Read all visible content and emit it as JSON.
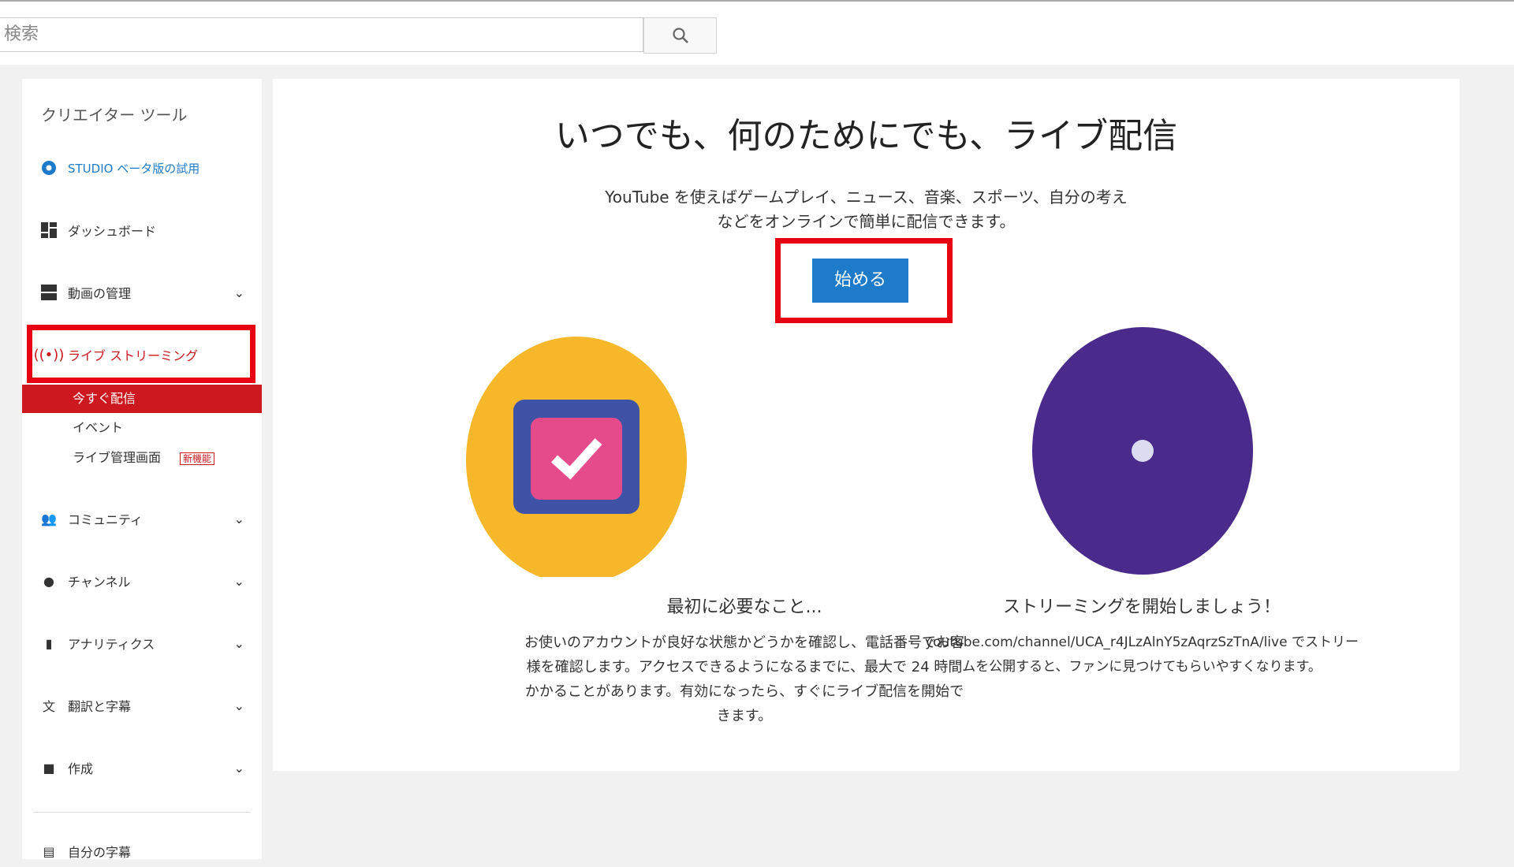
{
  "search": {
    "placeholder": "検索"
  },
  "sidebar": {
    "header": "クリエイター ツール",
    "studio": "STUDIO ベータ版の試用",
    "items": [
      {
        "label": "ダッシュボード"
      },
      {
        "label": "動画の管理"
      },
      {
        "label": "ライブ ストリーミング"
      },
      {
        "label": "コミュニティ"
      },
      {
        "label": "チャンネル"
      },
      {
        "label": "アナリティクス"
      },
      {
        "label": "翻訳と字幕"
      },
      {
        "label": "作成"
      }
    ],
    "sub": [
      {
        "label": "今すぐ配信"
      },
      {
        "label": "イベント"
      },
      {
        "label": "ライブ管理画面"
      }
    ],
    "badge": "新機能",
    "bottom": "自分の字幕"
  },
  "main": {
    "title": "いつでも、何のためにでも、ライブ配信",
    "desc": [
      "YouTube を使えばゲームプレイ、ニュース、音楽、スポーツ、自分の考え",
      "などをオンラインで簡単に配信できます。"
    ],
    "start": "始める",
    "left": {
      "title": "最初に必要なこと...",
      "lines": [
        "お使いのアカウントが良好な状態かどうかを確認し、電話番号でお客",
        "様を確認します。アクセスできるようになるまでに、最大で 24 時間",
        "かかることがあります。有効になったら、すぐにライブ配信を開始で",
        "きます。"
      ]
    },
    "right": {
      "title": "ストリーミングを開始しましょう！",
      "lines": [
        "youtube.com/channel/UCA_r4JLzAlnY5zAqrzSzTnA/live でストリー",
        "ムを公開すると、ファンに見つけてもらいやすくなります。"
      ]
    }
  },
  "colors": {
    "accent": "#1e7bc9",
    "red": "#cc181e",
    "highlight": "#e60012"
  }
}
